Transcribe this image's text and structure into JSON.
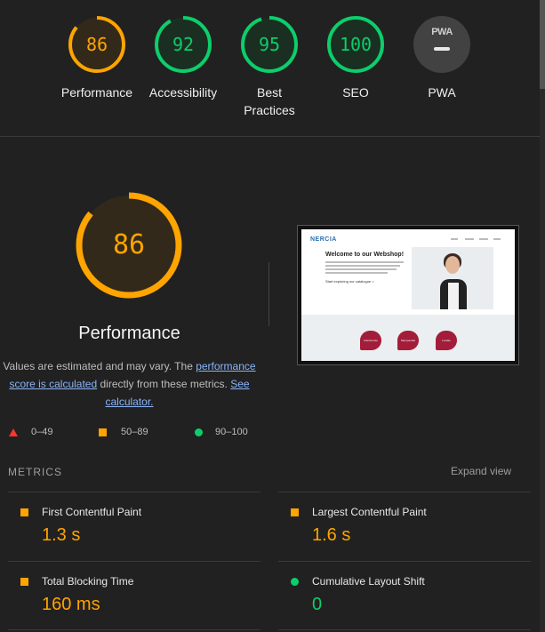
{
  "colors": {
    "background": "#212121",
    "pass": "#0cce6b",
    "average": "#ffa400",
    "fail": "#ff3333",
    "link": "#8ab4f8"
  },
  "categories": [
    {
      "id": "performance",
      "score": "86",
      "score_value": 86,
      "label": "Performance",
      "color": "#ffa400"
    },
    {
      "id": "accessibility",
      "score": "92",
      "score_value": 92,
      "label": "Accessibility",
      "color": "#0cce6b"
    },
    {
      "id": "best-practices",
      "score": "95",
      "score_value": 95,
      "label_line1": "Best",
      "label_line2": "Practices",
      "color": "#0cce6b"
    },
    {
      "id": "seo",
      "score": "100",
      "score_value": 100,
      "label": "SEO",
      "color": "#0cce6b"
    },
    {
      "id": "pwa",
      "badge": "PWA",
      "label": "PWA"
    }
  ],
  "main": {
    "score": "86",
    "score_value": 86,
    "title": "Performance",
    "desc_prefix": "Values are estimated and may vary. The ",
    "desc_link": "performance score is calculated",
    "desc_middle": " directly from these metrics. ",
    "calc_link": "See calculator."
  },
  "thumbnail": {
    "logo": "NERCIA",
    "heading": "Welcome to our Webshop!",
    "cta": "Start exploring our catalogue >",
    "buttons": [
      "Instrumente",
      "Steroperatie",
      "Locatie"
    ]
  },
  "legend": {
    "fail": "0–49",
    "average": "50–89",
    "pass": "90–100"
  },
  "metrics": {
    "title": "METRICS",
    "expand": "Expand view",
    "items": [
      {
        "name": "First Contentful Paint",
        "value": "1.3 s",
        "status": "average"
      },
      {
        "name": "Largest Contentful Paint",
        "value": "1.6 s",
        "status": "average"
      },
      {
        "name": "Total Blocking Time",
        "value": "160 ms",
        "status": "average"
      },
      {
        "name": "Cumulative Layout Shift",
        "value": "0",
        "status": "pass"
      }
    ]
  }
}
